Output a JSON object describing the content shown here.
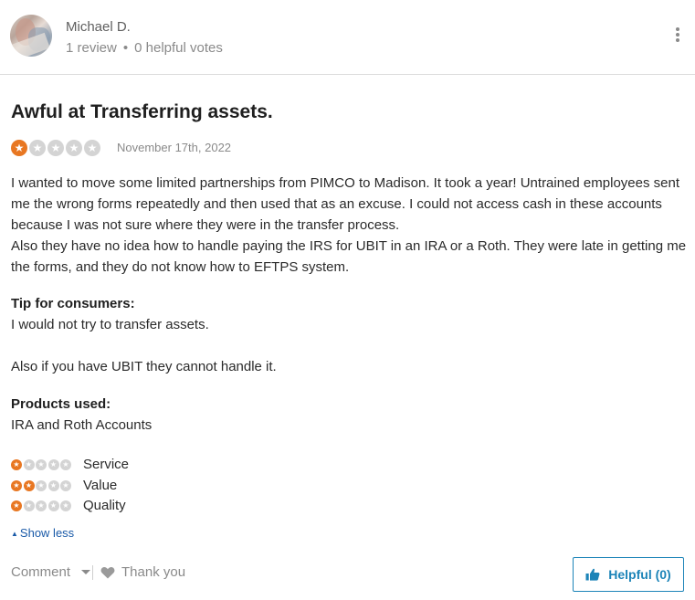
{
  "reviewer": {
    "name": "Michael D.",
    "reviews": "1 review",
    "separator": "•",
    "helpful_votes": "0 helpful votes"
  },
  "review": {
    "title": "Awful at Transferring assets.",
    "rating": 1,
    "rating_max": 5,
    "date": "November 17th, 2022",
    "body_lines": [
      "I wanted to move some limited partnerships from PIMCO to Madison. It took a year! Untrained employees sent me the wrong forms repeatedly and then used that as an excuse. I could not access cash in these accounts because I was not sure where they were in the transfer process.",
      "Also they have no idea how to handle paying the IRS for UBIT in an IRA or a Roth. They were late in getting me the forms, and they do not know how to EFTPS system."
    ],
    "tip_label": "Tip for consumers:",
    "tip_line1": "I would not try to transfer assets.",
    "tip_line2": "Also if you have UBIT they cannot handle it.",
    "products_label": "Products used:",
    "products_value": "IRA and Roth Accounts",
    "sub_ratings": [
      {
        "label": "Service",
        "value": 1
      },
      {
        "label": "Value",
        "value": 2
      },
      {
        "label": "Quality",
        "value": 1
      }
    ],
    "show_less": "Show less"
  },
  "footer": {
    "comment": "Comment",
    "thank_you": "Thank you",
    "helpful": "Helpful (0)"
  },
  "colors": {
    "star_on": "#e87722",
    "star_off": "#d4d4d4",
    "link": "#1a5aa8",
    "helpful_accent": "#1c84b8"
  },
  "icons": {
    "more": "kebab-menu-icon",
    "heart": "heart-icon",
    "thumb": "thumbs-up-icon",
    "caret": "caret-down-icon",
    "triangle": "triangle-up-icon"
  }
}
